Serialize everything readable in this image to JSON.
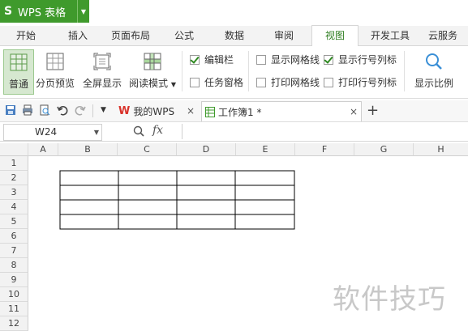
{
  "app": {
    "title": "WPS 表格",
    "brand_color": "#3f9a2c"
  },
  "menu": {
    "tabs": [
      "开始",
      "插入",
      "页面布局",
      "公式",
      "数据",
      "审阅",
      "视图",
      "开发工具",
      "云服务"
    ],
    "active": "视图"
  },
  "ribbon": {
    "buttons": [
      {
        "label": "普通",
        "icon": "normal-view-icon",
        "active": true
      },
      {
        "label": "分页预览",
        "icon": "page-break-preview-icon"
      },
      {
        "label": "全屏显示",
        "icon": "fullscreen-icon"
      },
      {
        "label": "阅读模式",
        "icon": "reading-mode-icon",
        "dropdown": true
      },
      {
        "label": "显示比例",
        "icon": "zoom-icon"
      }
    ],
    "checkboxes": [
      {
        "label": "编辑栏",
        "checked": true
      },
      {
        "label": "任务窗格",
        "checked": false
      },
      {
        "label": "显示网格线",
        "checked": false
      },
      {
        "label": "打印网格线",
        "checked": false
      },
      {
        "label": "显示行号列标",
        "checked": true
      },
      {
        "label": "打印行号列标",
        "checked": false
      }
    ]
  },
  "doctabs": [
    {
      "label": "我的WPS",
      "icon": "wps-logo-icon"
    },
    {
      "label": "工作簿1 *",
      "icon": "spreadsheet-icon",
      "active": true
    }
  ],
  "formula": {
    "cell_ref": "W24",
    "fx_label": "fx",
    "value": ""
  },
  "grid": {
    "columns": [
      "A",
      "B",
      "C",
      "D",
      "E",
      "F",
      "G",
      "H"
    ],
    "rows": [
      "1",
      "2",
      "3",
      "4",
      "5",
      "6",
      "7",
      "8",
      "9",
      "10",
      "11",
      "12"
    ]
  },
  "watermark": "软件技巧"
}
